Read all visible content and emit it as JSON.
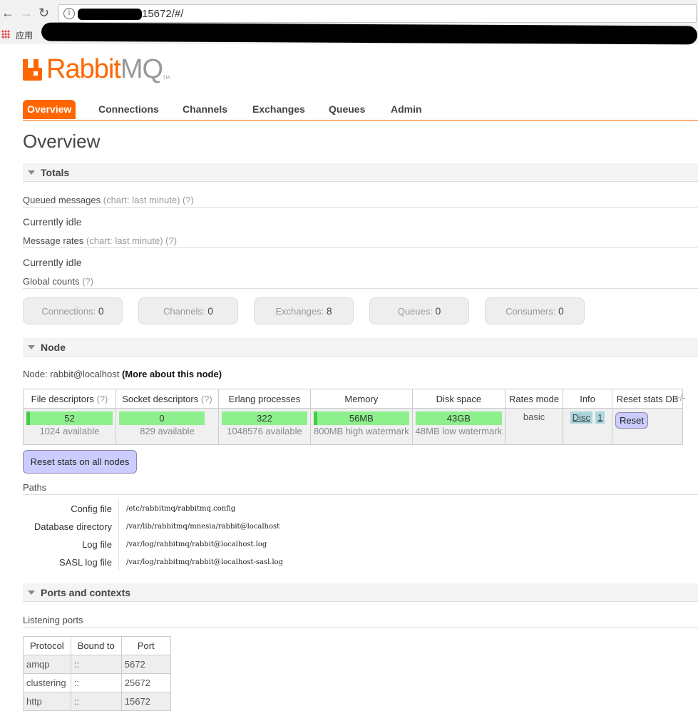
{
  "browser": {
    "url_visible": "15672/#/",
    "bookmark_apps": "应用"
  },
  "brand": {
    "name_orange": "Rabbit",
    "name_grey": "MQ",
    "tm": "TM"
  },
  "tabs": [
    "Overview",
    "Connections",
    "Channels",
    "Exchanges",
    "Queues",
    "Admin"
  ],
  "page_title": "Overview",
  "totals": {
    "title": "Totals",
    "queued_label": "Queued messages",
    "queued_hint": "(chart: last minute) (?)",
    "queued_status": "Currently idle",
    "rates_label": "Message rates",
    "rates_hint": "(chart: last minute) (?)",
    "rates_status": "Currently idle",
    "global_label": "Global counts",
    "global_hint": "(?)",
    "counts": [
      {
        "label": "Connections:",
        "value": "0"
      },
      {
        "label": "Channels:",
        "value": "0"
      },
      {
        "label": "Exchanges:",
        "value": "8"
      },
      {
        "label": "Queues:",
        "value": "0"
      },
      {
        "label": "Consumers:",
        "value": "0"
      }
    ]
  },
  "node": {
    "title": "Node",
    "node_prefix": "Node: rabbit@localhost",
    "more_link": "(More about this node)",
    "headers": {
      "fd": "File descriptors",
      "fd_hint": "(?)",
      "sd": "Socket descriptors",
      "sd_hint": "(?)",
      "erl": "Erlang processes",
      "mem": "Memory",
      "disk": "Disk space",
      "rates": "Rates mode",
      "info": "Info",
      "reset": "Reset stats DB"
    },
    "plusminus": "+/-",
    "row": {
      "fd_value": "52",
      "fd_sub": "1024 available",
      "sd_value": "0",
      "sd_sub": "829 available",
      "erl_value": "322",
      "erl_sub": "1048576 available",
      "mem_value": "56MB",
      "mem_sub": "800MB high watermark",
      "disk_value": "43GB",
      "disk_sub": "48MB low watermark",
      "rates_mode": "basic",
      "info_badge1": "Disc",
      "info_badge2": "1",
      "reset_label": "Reset"
    },
    "reset_all_label": "Reset stats on all nodes"
  },
  "paths": {
    "title": "Paths",
    "rows": [
      {
        "key": "Config file",
        "value": "/etc/rabbitmq/rabbitmq.config"
      },
      {
        "key": "Database directory",
        "value": "/var/lib/rabbitmq/mnesia/rabbit@localhost"
      },
      {
        "key": "Log file",
        "value": "/var/log/rabbitmq/rabbit@localhost.log"
      },
      {
        "key": "SASL log file",
        "value": "/var/log/rabbitmq/rabbit@localhost-sasl.log"
      }
    ]
  },
  "ports": {
    "title": "Ports and contexts",
    "listening": "Listening ports",
    "headers": [
      "Protocol",
      "Bound to",
      "Port"
    ],
    "rows": [
      [
        "amqp",
        "::",
        "5672"
      ],
      [
        "clustering",
        "::",
        "25672"
      ],
      [
        "http",
        "::",
        "15672"
      ]
    ]
  },
  "colors": {
    "accent": "#ff6600",
    "bar": "#8df08d",
    "button": "#ccccff"
  }
}
